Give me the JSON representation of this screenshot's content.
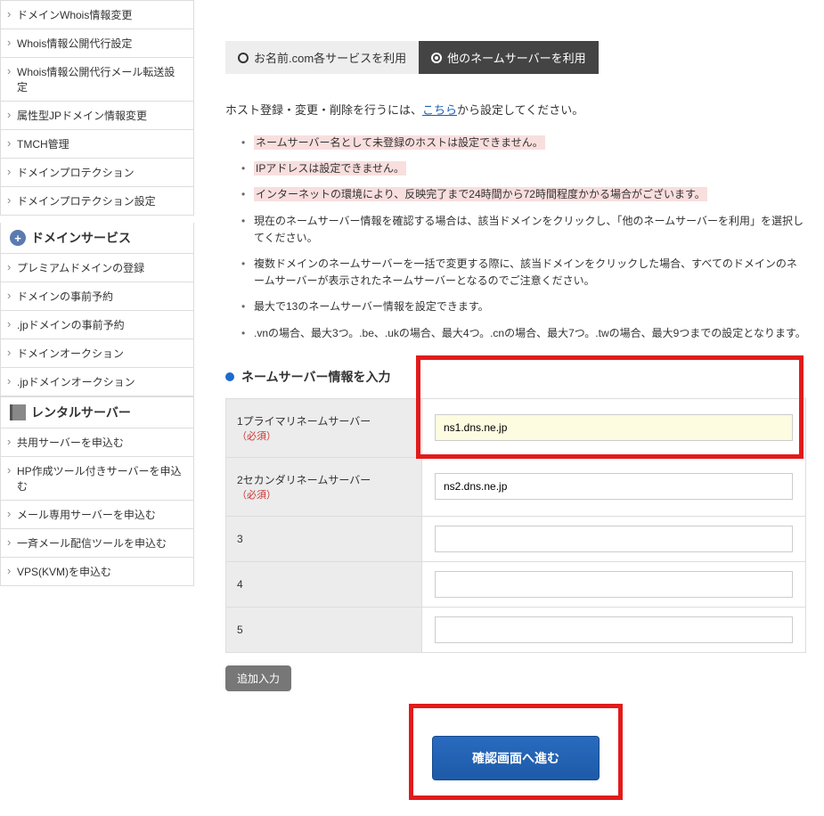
{
  "sidebar": {
    "top_items": [
      "ドメインWhois情報変更",
      "Whois情報公開代行設定",
      "Whois情報公開代行メール転送設定",
      "属性型JPドメイン情報変更",
      "TMCH管理",
      "ドメインプロテクション",
      "ドメインプロテクション設定"
    ],
    "section1_title": "ドメインサービス",
    "section1_items": [
      "プレミアムドメインの登録",
      "ドメインの事前予約",
      ".jpドメインの事前予約",
      "ドメインオークション",
      ".jpドメインオークション"
    ],
    "section2_title": "レンタルサーバー",
    "section2_items": [
      "共用サーバーを申込む",
      "HP作成ツール付きサーバーを申込む",
      "メール専用サーバーを申込む",
      "一斉メール配信ツールを申込む",
      "VPS(KVM)を申込む"
    ]
  },
  "tabs": {
    "inactive": "お名前.com各サービスを利用",
    "active": "他のネームサーバーを利用"
  },
  "host_text_before": "ホスト登録・変更・削除を行うには、",
  "host_link": "こちら",
  "host_text_after": "から設定してください。",
  "notes": [
    {
      "text": "ネームサーバー名として未登録のホストは設定できません。",
      "hl": true
    },
    {
      "text": "IPアドレスは設定できません。",
      "hl": true
    },
    {
      "text": "インターネットの環境により、反映完了まで24時間から72時間程度かかる場合がございます。",
      "hl": true
    },
    {
      "text": "現在のネームサーバー情報を確認する場合は、該当ドメインをクリックし、「他のネームサーバーを利用」を選択してください。",
      "hl": false
    },
    {
      "text": "複数ドメインのネームサーバーを一括で変更する際に、該当ドメインをクリックした場合、すべてのドメインのネームサーバーが表示されたネームサーバーとなるのでご注意ください。",
      "hl": false
    },
    {
      "text": "最大で13のネームサーバー情報を設定できます。",
      "hl": false
    },
    {
      "text": ".vnの場合、最大3つ。.be、.ukの場合、最大4つ。.cnの場合、最大7つ。.twの場合、最大9つまでの設定となります。",
      "hl": false
    }
  ],
  "section_title": "ネームサーバー情報を入力",
  "required": "（必須）",
  "rows": [
    {
      "label": "1プライマリネームサーバー",
      "required": true,
      "value": "ns1.dns.ne.jp",
      "yellow": true
    },
    {
      "label": "2セカンダリネームサーバー",
      "required": true,
      "value": "ns2.dns.ne.jp",
      "yellow": false
    },
    {
      "label": "3",
      "required": false,
      "value": "",
      "yellow": false
    },
    {
      "label": "4",
      "required": false,
      "value": "",
      "yellow": false
    },
    {
      "label": "5",
      "required": false,
      "value": "",
      "yellow": false
    }
  ],
  "add_label": "追加入力",
  "submit_label": "確認画面へ進む"
}
